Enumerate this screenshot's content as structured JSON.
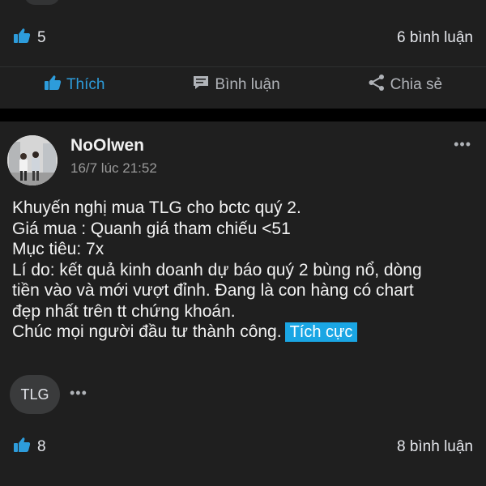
{
  "prev_post": {
    "like_count": "5",
    "comment_count": "6 bình luận",
    "actions": {
      "like_label": "Thích",
      "comment_label": "Bình luận",
      "share_label": "Chia sẻ"
    }
  },
  "post": {
    "author": "NoOlwen",
    "time": "16/7 lúc 21:52",
    "more": "•••",
    "body_lines": [
      "Khuyến nghị mua TLG cho bctc quý 2.",
      "Giá mua : Quanh giá tham chiếu <51",
      "Mục tiêu: 7x",
      "Lí do: kết quả kinh doanh dự báo quý 2 bùng nổ, dòng",
      "tiền vào và mới vượt đỉnh. Đang là con hàng có chart",
      "đẹp nhất trên tt chứng khoán.",
      "Chúc mọi người đầu tư thành công."
    ],
    "sentiment_tag": "Tích cực",
    "stock_tag": "TLG",
    "tag_more": "•••",
    "like_count": "8",
    "comment_count": "8 bình luận"
  },
  "colors": {
    "accent": "#2d9cdb",
    "sentiment_bg": "#1aa6e4",
    "card_bg": "#1f1f1f"
  },
  "icons": [
    "thumbs-up-icon",
    "comment-icon",
    "share-icon",
    "more-icon"
  ]
}
